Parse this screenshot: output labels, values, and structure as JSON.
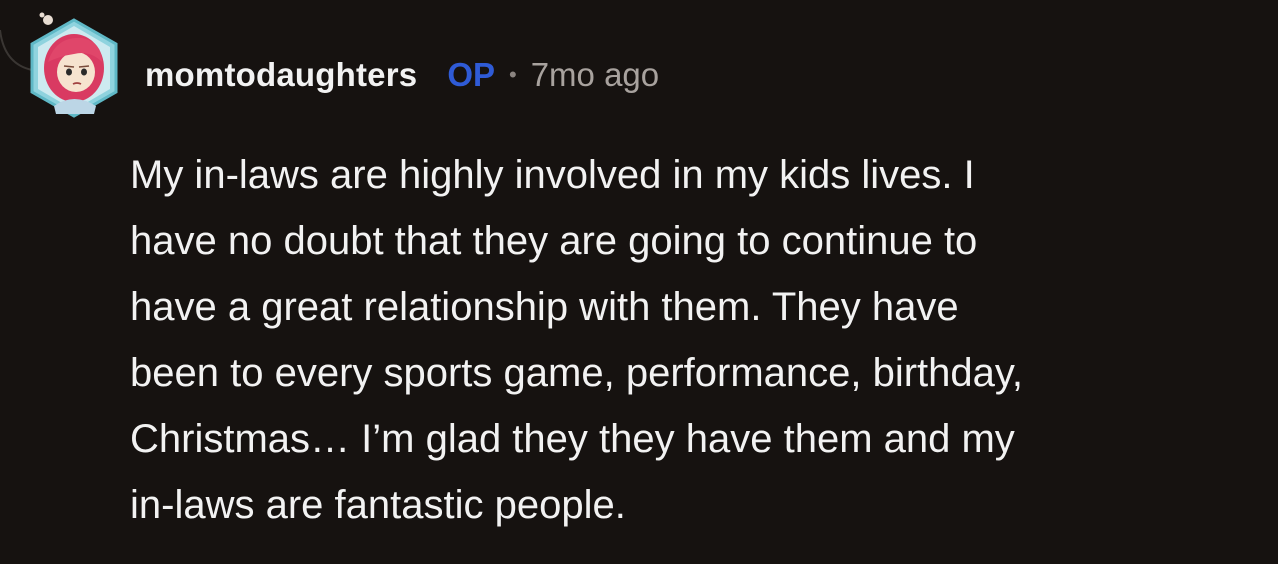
{
  "comment": {
    "author": "momtodaughters",
    "op_badge": "OP",
    "separator": "•",
    "timestamp": "7mo ago",
    "avatar_icon": "avatar-pink-hair-character-icon",
    "body_lines": [
      "My in-laws are highly involved in my kids lives. I",
      "have no doubt that they are going to continue to",
      "have a great relationship with them. They have",
      "been to every sports game, performance, birthday,",
      "Christmas… I’m glad they they have them and my",
      "in-laws are fantastic people."
    ]
  },
  "colors": {
    "background": "#161210",
    "username": "#f2f2f2",
    "op_badge": "#2f5bd6",
    "timestamp": "#a8a29e",
    "body_text": "#f2f2f2",
    "avatar_frame": "#7fd0d8",
    "avatar_hair": "#e0466a"
  }
}
